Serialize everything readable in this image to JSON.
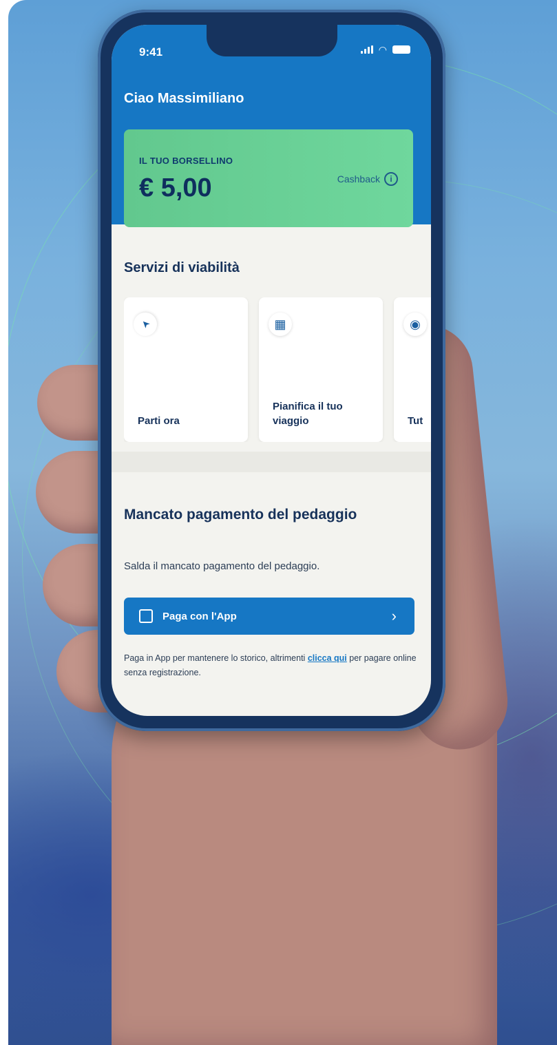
{
  "status_bar": {
    "time": "9:41"
  },
  "header": {
    "greeting": "Ciao Massimiliano"
  },
  "wallet": {
    "label": "IL TUO BORSELLINO",
    "amount": "€ 5,00",
    "cashback_label": "Cashback",
    "info_glyph": "i"
  },
  "services": {
    "title": "Servizi di viabilità",
    "cards": [
      {
        "icon": "navigation-arrow-icon",
        "glyph": "➤",
        "label": "Parti ora"
      },
      {
        "icon": "calendar-icon",
        "glyph": "▦",
        "label": "Pianifica il tuo\nviaggio"
      },
      {
        "icon": "service-icon",
        "glyph": "◉",
        "label": "Tut"
      }
    ]
  },
  "mancato": {
    "title": "Mancato pagamento del pedaggio",
    "subtitle": "Salda il mancato pagamento del pedaggio.",
    "button_label": "Paga con l'App",
    "chevron": "›",
    "footnote_before": "Paga in App per mantenere lo storico, altrimenti ",
    "footnote_link": "clicca qui",
    "footnote_after": " per pagare online senza registrazione."
  },
  "colors": {
    "primary": "#1677c4",
    "wallet_green": "#6fd79d",
    "text_dark": "#17325a"
  }
}
